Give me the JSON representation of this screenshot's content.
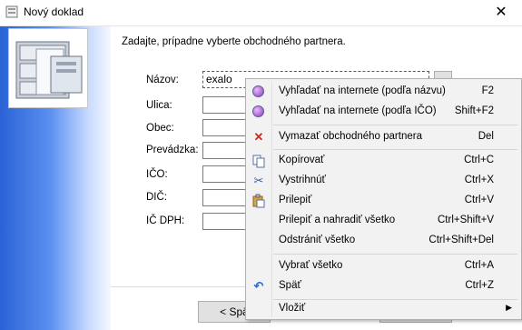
{
  "window": {
    "title": "Nový doklad"
  },
  "instruction": "Zadajte, prípadne vyberte obchodného partnera.",
  "form": {
    "fields": [
      {
        "label": "Názov:",
        "value": "exalo"
      },
      {
        "label": "Ulica:",
        "value": ""
      },
      {
        "label": "Obec:",
        "value": ""
      },
      {
        "label": "Prevádzka:",
        "value": ""
      },
      {
        "label": "IČO:",
        "value": ""
      },
      {
        "label": "DIČ:",
        "value": ""
      },
      {
        "label": "IČ DPH:",
        "value": ""
      }
    ]
  },
  "footer": {
    "back_label": "< Spä"
  },
  "context_menu": {
    "items": [
      {
        "label": "Vyhľadať na internete (podľa názvu)",
        "shortcut": "F2",
        "icon": "web-search-icon"
      },
      {
        "label": "Vyhľadať na internete (podľa IČO)",
        "shortcut": "Shift+F2",
        "icon": "web-search-icon"
      },
      {
        "label": "Vymazať obchodného partnera",
        "shortcut": "Del",
        "icon": "delete-x-icon"
      },
      {
        "label": "Kopírovať",
        "shortcut": "Ctrl+C",
        "icon": "copy-icon"
      },
      {
        "label": "Vystrihnúť",
        "shortcut": "Ctrl+X",
        "icon": "cut-icon"
      },
      {
        "label": "Prilepiť",
        "shortcut": "Ctrl+V",
        "icon": "paste-icon"
      },
      {
        "label": "Prilepiť a nahradiť všetko",
        "shortcut": "Ctrl+Shift+V",
        "icon": ""
      },
      {
        "label": "Odstrániť všetko",
        "shortcut": "Ctrl+Shift+Del",
        "icon": ""
      },
      {
        "label": "Vybrať všetko",
        "shortcut": "Ctrl+A",
        "icon": ""
      },
      {
        "label": "Späť",
        "shortcut": "Ctrl+Z",
        "icon": "undo-icon"
      },
      {
        "label": "Vložiť",
        "shortcut": "",
        "icon": ""
      }
    ]
  },
  "colors": {
    "panel_gradient_start": "#2a63d6",
    "delete_red": "#d9261c",
    "undo_blue": "#2b6fd6"
  }
}
